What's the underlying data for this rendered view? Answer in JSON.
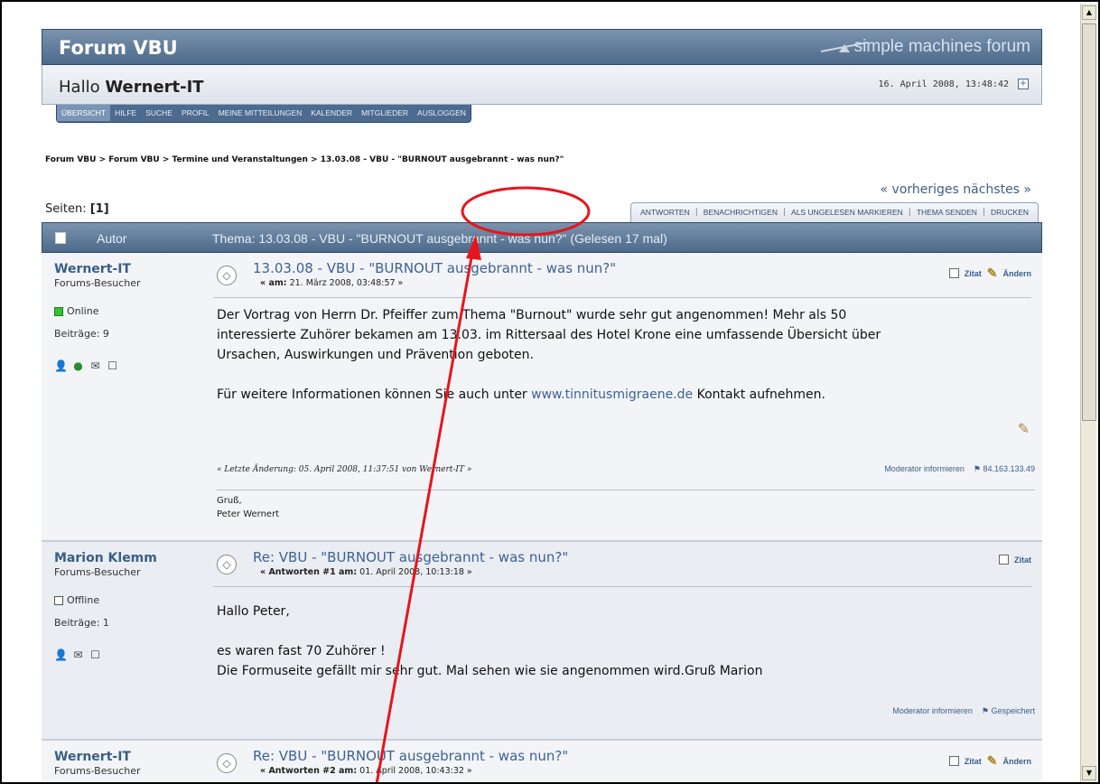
{
  "header": {
    "forum_title": "Forum VBU",
    "logo_text": "simple machines forum",
    "greeting_prefix": "Hallo",
    "username": "Wernert-IT",
    "datetime": "16. April 2008, 13:48:42"
  },
  "main_menu": {
    "items": [
      "Übersicht",
      "Hilfe",
      "Suche",
      "Profil",
      "Meine Mitteilungen",
      "Kalender",
      "Mitglieder",
      "Ausloggen"
    ]
  },
  "breadcrumb": "Forum VBU > Forum VBU > Termine und Veranstaltungen > 13.03.08 - VBU - \"BURNOUT ausgebrannt - was nun?\"",
  "navigation": {
    "prev_next": "« vorheriges nächstes »"
  },
  "pages": {
    "label": "Seiten:",
    "value": "[1]"
  },
  "topic_buttons": [
    "Antworten",
    "Benachrichtigen",
    "Als ungelesen markieren",
    "Thema senden",
    "Drucken"
  ],
  "category_bar": {
    "author_label": "Autor",
    "topic_label": "Thema: 13.03.08 - VBU - \"BURNOUT ausgebrannt - was nun?\"  (Gelesen 17 mal)"
  },
  "posts": [
    {
      "author": "Wernert-IT",
      "group": "Forums-Besucher",
      "status": "Online",
      "post_count": "Beiträge: 9",
      "subject": "13.03.08 - VBU - \"BURNOUT ausgebrannt - was nun?\"",
      "meta_prefix": "« am:",
      "meta_date": "21. März 2008, 03:48:57 »",
      "actions": [
        "Zitat",
        "Ändern"
      ],
      "body": [
        "Der Vortrag von Herrn Dr. Pfeiffer zum Thema \"Burnout\" wurde sehr gut angenommen! Mehr als 50",
        "interessierte Zuhörer bekamen am 13.03. im Rittersaal des Hotel Krone eine umfassende Übersicht über",
        "Ursachen, Auswirkungen und Prävention geboten."
      ],
      "body_more_prefix": "Für weitere Informationen können Sie auch unter",
      "body_link": "www.tinnitusmigraene.de",
      "body_more_suffix": "Kontakt aufnehmen.",
      "last_edit": "« Letzte Änderung: 05. April 2008, 11:37:51 von Wernert-IT »",
      "moderator_link": "Moderator informieren",
      "ip": "84.163.133.49",
      "signature": [
        "Gruß,",
        "Peter Wernert"
      ]
    },
    {
      "author": "Marion Klemm",
      "group": "Forums-Besucher",
      "status": "Offline",
      "post_count": "Beiträge: 1",
      "subject": "Re: VBU - \"BURNOUT ausgebrannt - was nun?\"",
      "meta_prefix": "« Antworten #1 am:",
      "meta_date": "01. April 2008, 10:13:18 »",
      "actions": [
        "Zitat"
      ],
      "body": [
        "Hallo Peter,",
        "",
        "es waren fast 70 Zuhörer !",
        "Die Formuseite gefällt mir sehr gut. Mal sehen wie sie angenommen wird.Gruß Marion"
      ],
      "moderator_link": "Moderator informieren",
      "ip": "Gespeichert"
    },
    {
      "author": "Wernert-IT",
      "group": "Forums-Besucher",
      "subject": "Re: VBU - \"BURNOUT ausgebrannt - was nun?\"",
      "meta_prefix": "« Antworten #2 am:",
      "meta_date": "01. April 2008, 10:43:32 »",
      "actions": [
        "Zitat",
        "Ändern"
      ]
    }
  ],
  "annotation": {
    "color": "#e8141c"
  }
}
